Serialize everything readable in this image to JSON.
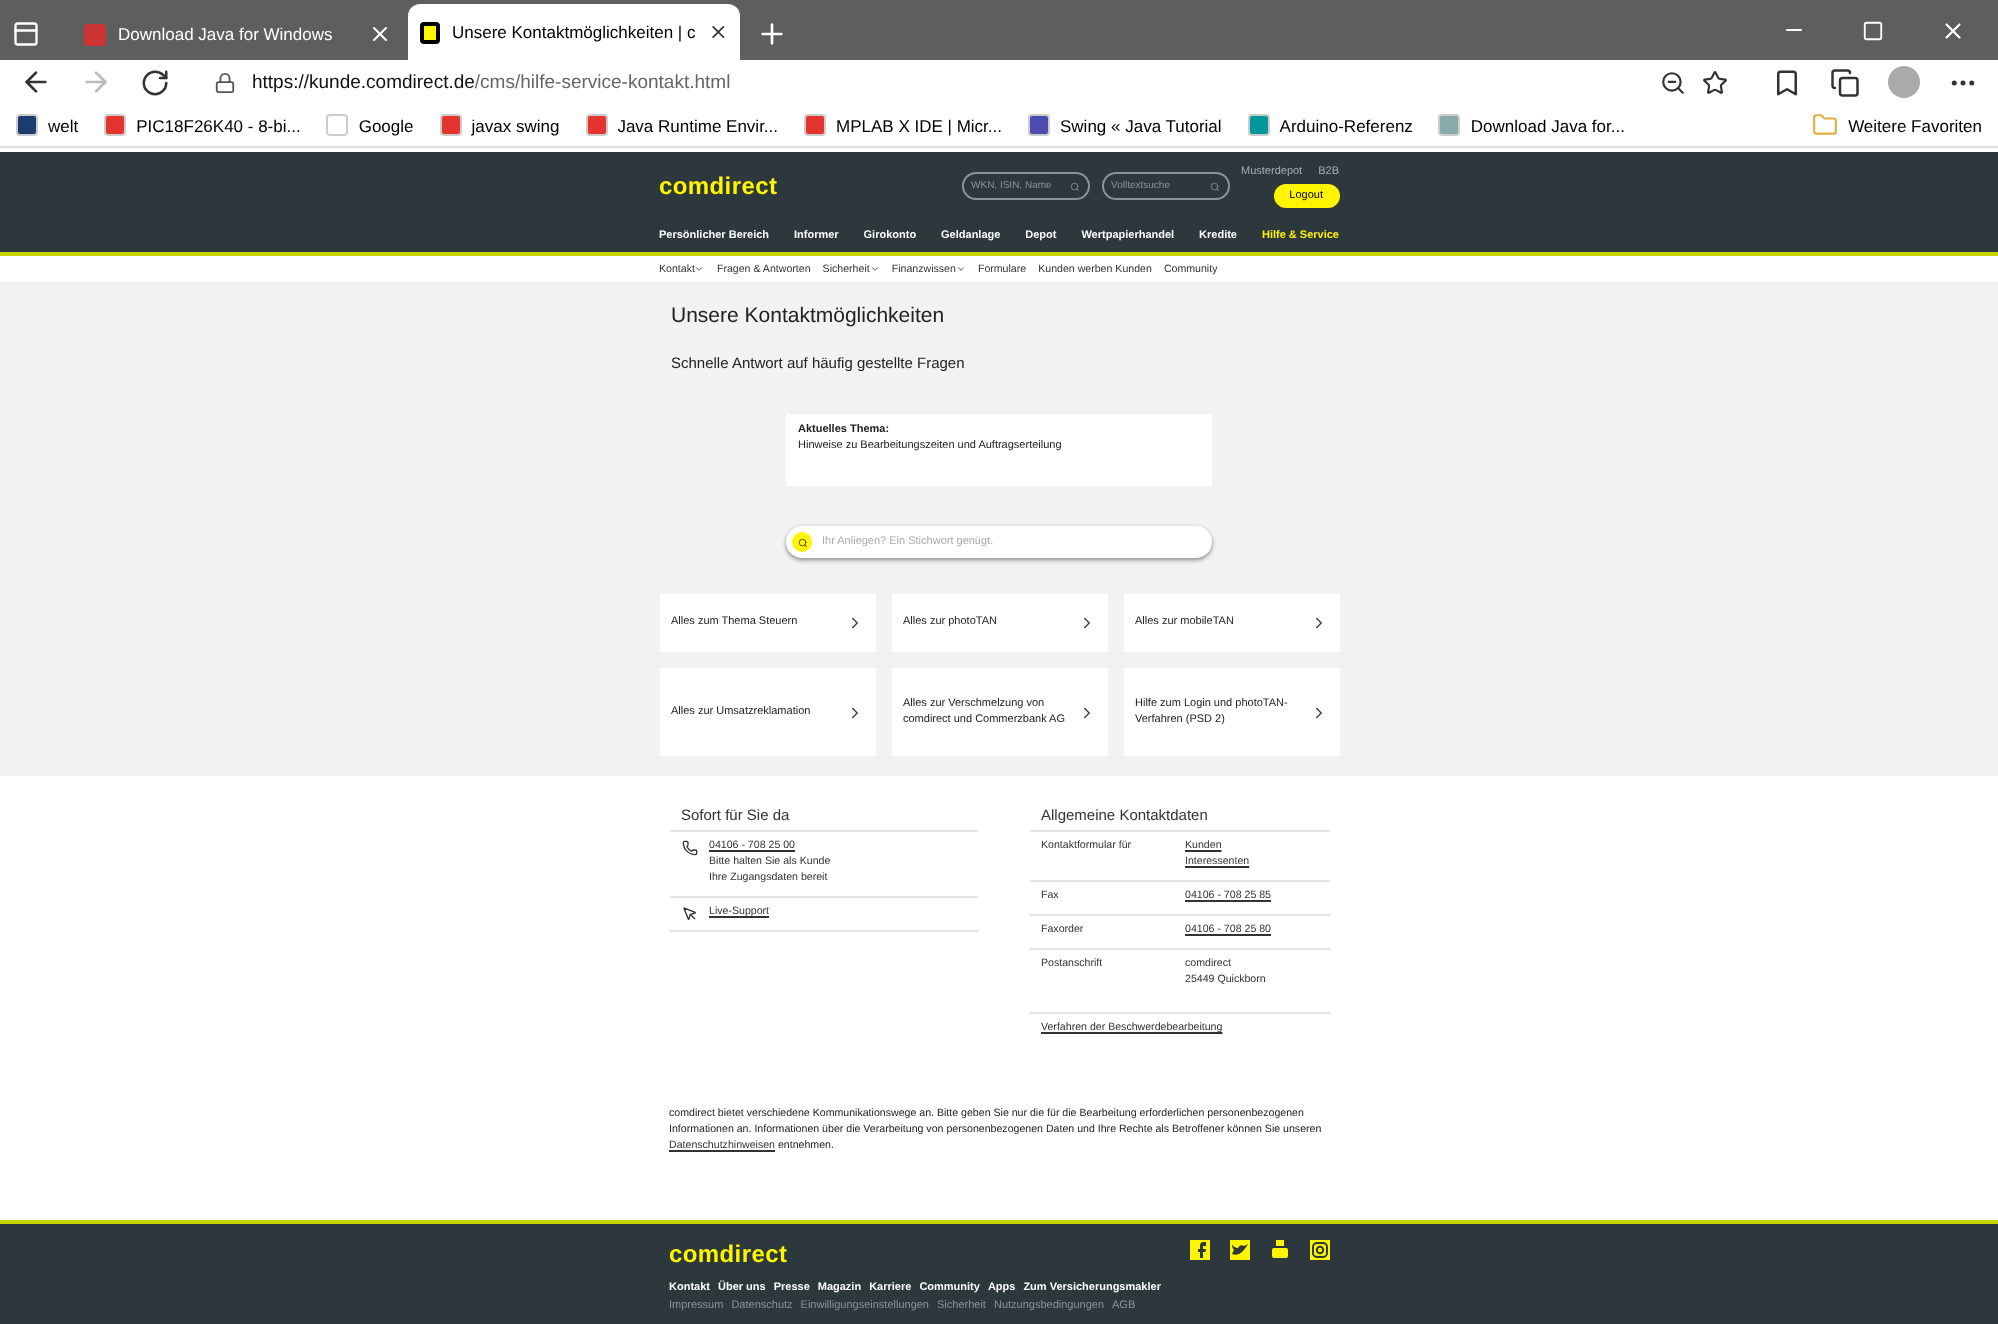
{
  "browser": {
    "tabs": [
      {
        "title": "Download Java for Windows",
        "selected": false
      },
      {
        "title": "Unsere Kontaktmöglichkeiten | c",
        "selected": true
      }
    ],
    "url_host": "https://kunde.comdirect.de",
    "url_path": "/cms/hilfe-service-kontakt.html",
    "bookmarks": [
      "welt",
      "PIC18F26K40 - 8-bi...",
      "Google",
      "javax swing",
      "Java Runtime Envir...",
      "MPLAB X IDE | Micr...",
      "Swing « Java Tutorial",
      "Arduino-Referenz",
      "Download Java for..."
    ],
    "other_favorites": "Weitere Favoriten"
  },
  "header": {
    "logo": "comdirect",
    "search_fields": [
      {
        "placeholder": "WKN, ISIN, Name"
      },
      {
        "placeholder": "Volltextsuche"
      }
    ],
    "links": [
      "Musterdepot",
      "B2B"
    ],
    "logout": "Logout",
    "nav": [
      {
        "label": "Persönlicher Bereich",
        "selected": false
      },
      {
        "label": "Informer",
        "selected": false
      },
      {
        "label": "Girokonto",
        "selected": false
      },
      {
        "label": "Geldanlage",
        "selected": false
      },
      {
        "label": "Depot",
        "selected": false
      },
      {
        "label": "Wertpapierhandel",
        "selected": false
      },
      {
        "label": "Kredite",
        "selected": false
      },
      {
        "label": "Hilfe & Service",
        "selected": true
      }
    ],
    "subnav": [
      {
        "label": "Kontakt",
        "has_menu": true
      },
      {
        "label": "Fragen & Antworten",
        "has_menu": false
      },
      {
        "label": "Sicherheit",
        "has_menu": true
      },
      {
        "label": "Finanzwissen",
        "has_menu": true
      },
      {
        "label": "Formulare",
        "has_menu": false
      },
      {
        "label": "Kunden werben Kunden",
        "has_menu": false
      },
      {
        "label": "Community",
        "has_menu": false
      }
    ]
  },
  "main": {
    "title": "Unsere Kontaktmöglichkeiten",
    "subtitle": "Schnelle Antwort auf häufig gestellte Fragen",
    "notice": {
      "title": "Aktuelles Thema:",
      "text": "Hinweise zu Bearbeitungszeiten und Auftragserteilung"
    },
    "search": {
      "placeholder": "Ihr Anliegen? Ein Stichwort genügt."
    },
    "tiles": [
      "Alles zum Thema Steuern",
      "Alles zur photoTAN",
      "Alles zur mobileTAN",
      "Alles zur Umsatzreklamation",
      "Alles zur Verschmelzung von comdirect und Commerzbank AG",
      "Hilfe zum Login und photoTAN-Verfahren (PSD 2)"
    ]
  },
  "contact": {
    "left_heading": "Sofort für Sie da",
    "phone": "04106 - 708 25 00",
    "phone_note": [
      "Bitte halten Sie als Kunde",
      "Ihre Zugangsdaten bereit"
    ],
    "live_support": "Live-Support",
    "right_heading": "Allgemeine Kontaktdaten",
    "rows": [
      {
        "label": "Kontaktformular für",
        "values": [
          "Kunden",
          "Interessenten"
        ],
        "links": true
      },
      {
        "label": "Fax",
        "values": [
          "04106 - 708 25 85"
        ],
        "links": true
      },
      {
        "label": "Faxorder",
        "values": [
          "04106 - 708 25 80"
        ],
        "links": true
      },
      {
        "label": "Postanschrift",
        "values": [
          "comdirect",
          "25449 Quickborn"
        ],
        "links": false
      }
    ],
    "complaint_link": "Verfahren der Beschwerdebearbeitung"
  },
  "privacy": {
    "text": "comdirect bietet verschiedene Kommunikationswege an. Bitte geben Sie nur die für die Bearbeitung erforderlichen personenbezogenen Informationen an. Informationen über die Verarbeitung von personenbezogenen Daten und Ihre Rechte als Betroffener können Sie unseren",
    "link": "Datenschutzhinweisen",
    "after": "entnehmen."
  },
  "footer": {
    "logo": "comdirect",
    "links": [
      "Kontakt",
      "Über uns",
      "Presse",
      "Magazin",
      "Karriere",
      "Community",
      "Apps",
      "Zum Versicherungsmakler"
    ],
    "legal": [
      "Impressum",
      "Datenschutz",
      "Einwilligungseinstellungen",
      "Sicherheit",
      "Nutzungsbedingungen",
      "AGB"
    ]
  }
}
